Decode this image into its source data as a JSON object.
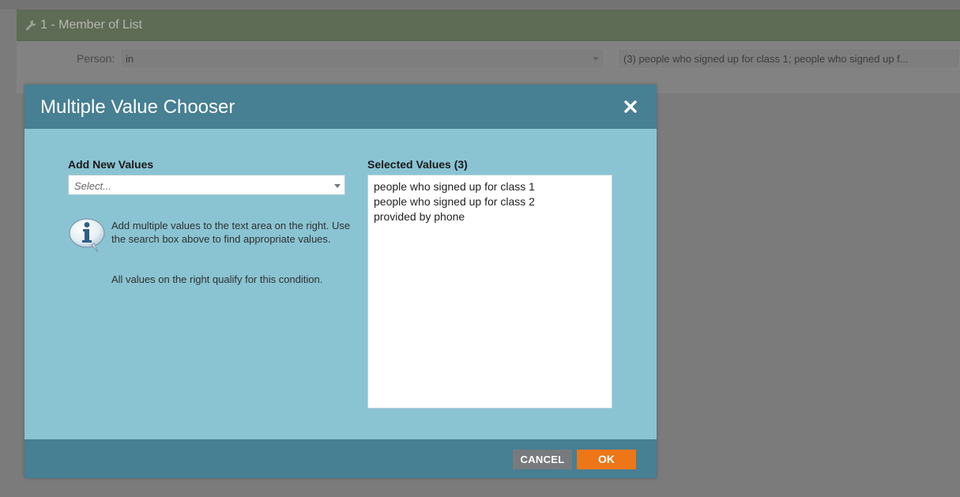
{
  "background": {
    "filter_title": "1 - Member of List",
    "person_label": "Person:",
    "operator_value": "in",
    "values_summary": "(3) people who signed up for class 1; people who signed up f..."
  },
  "modal": {
    "title": "Multiple Value Chooser",
    "close_icon": "close-icon",
    "add_new": {
      "label": "Add New Values",
      "placeholder": "Select..."
    },
    "info": {
      "icon": "info-icon",
      "line1": "Add multiple values to the text area on the right. Use the search box above to find appropriate values.",
      "line2": "All values on the right qualify for this condition."
    },
    "selected": {
      "label": "Selected Values (3)",
      "values": [
        "people who signed up for class 1",
        "people who signed up for class 2",
        "provided by phone"
      ]
    },
    "buttons": {
      "cancel": "CANCEL",
      "ok": "OK"
    }
  },
  "colors": {
    "modal_header": "#477f93",
    "modal_body": "#8ac4d3",
    "ok_button": "#ec7618",
    "cancel_button": "#777b7d"
  }
}
